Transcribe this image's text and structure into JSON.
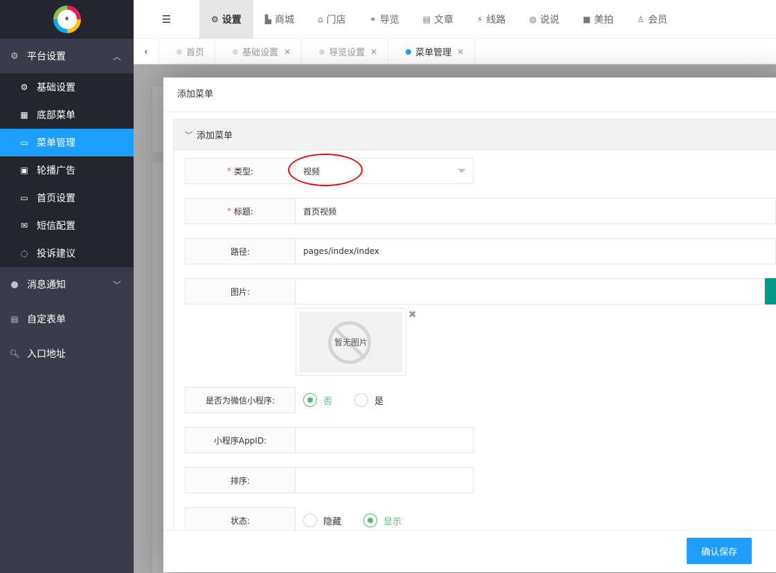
{
  "sidebar": {
    "logo_text": "logo",
    "groups": [
      {
        "label": "平台设置",
        "icon": "gear-icon",
        "open": true
      },
      {
        "label": "消息通知",
        "icon": "chat-bubble-icon"
      },
      {
        "label": "自定表单",
        "icon": "form-icon"
      },
      {
        "label": "入口地址",
        "icon": "search-icon"
      }
    ],
    "sub_items": [
      {
        "label": "基础设置",
        "icon": "gear-icon"
      },
      {
        "label": "底部菜单",
        "icon": "grid-icon"
      },
      {
        "label": "菜单管理",
        "icon": "monitor-icon",
        "active": true
      },
      {
        "label": "轮播广告",
        "icon": "image-icon"
      },
      {
        "label": "首页设置",
        "icon": "monitor-icon"
      },
      {
        "label": "短信配置",
        "icon": "mail-icon"
      },
      {
        "label": "投诉建议",
        "icon": "comment-icon"
      }
    ]
  },
  "topnav": {
    "toggle_icon": "menu-toggle-icon",
    "items": [
      {
        "label": "设置",
        "icon": "gears-icon",
        "active": true
      },
      {
        "label": "商城",
        "icon": "shop-icon"
      },
      {
        "label": "门店",
        "icon": "bank-icon"
      },
      {
        "label": "导览",
        "icon": "share-icon"
      },
      {
        "label": "文章",
        "icon": "newspaper-icon"
      },
      {
        "label": "线路",
        "icon": "route-icon"
      },
      {
        "label": "说说",
        "icon": "wechat-icon"
      },
      {
        "label": "美拍",
        "icon": "video-camera-icon"
      },
      {
        "label": "会员",
        "icon": "user-icon"
      }
    ]
  },
  "tabs": [
    {
      "label": "首页",
      "closable": false
    },
    {
      "label": "基础设置",
      "closable": true
    },
    {
      "label": "导览设置",
      "closable": true
    },
    {
      "label": "菜单管理",
      "closable": true,
      "active": true
    }
  ],
  "modal": {
    "title": "添加菜单",
    "panel_title": "添加菜单",
    "fields": {
      "type": {
        "label": "类型:",
        "required": true,
        "value": "视频"
      },
      "title": {
        "label": "标题:",
        "required": true,
        "value": "首页视频"
      },
      "path": {
        "label": "路径:",
        "value": "pages/index/index"
      },
      "image": {
        "label": "图片:",
        "value": "",
        "placeholder_text": "暂无图片"
      },
      "is_miniprogram": {
        "label": "是否为微信小程序:",
        "options": [
          "否",
          "是"
        ],
        "selected": "否"
      },
      "appid": {
        "label": "小程序AppID:",
        "value": ""
      },
      "sort": {
        "label": "排序:",
        "value": ""
      },
      "status": {
        "label": "状态:",
        "options": [
          "隐藏",
          "显示"
        ],
        "selected": "显示"
      }
    },
    "save_label": "确认保存"
  },
  "colors": {
    "sidebar_bg": "#393d49",
    "sidebar_sub_bg": "#23262e",
    "active_blue": "#1e9fff",
    "radio_green": "#5fb878",
    "required_red": "#ff5722",
    "annotation_red": "#e10d0d",
    "teal_button": "#009688"
  }
}
